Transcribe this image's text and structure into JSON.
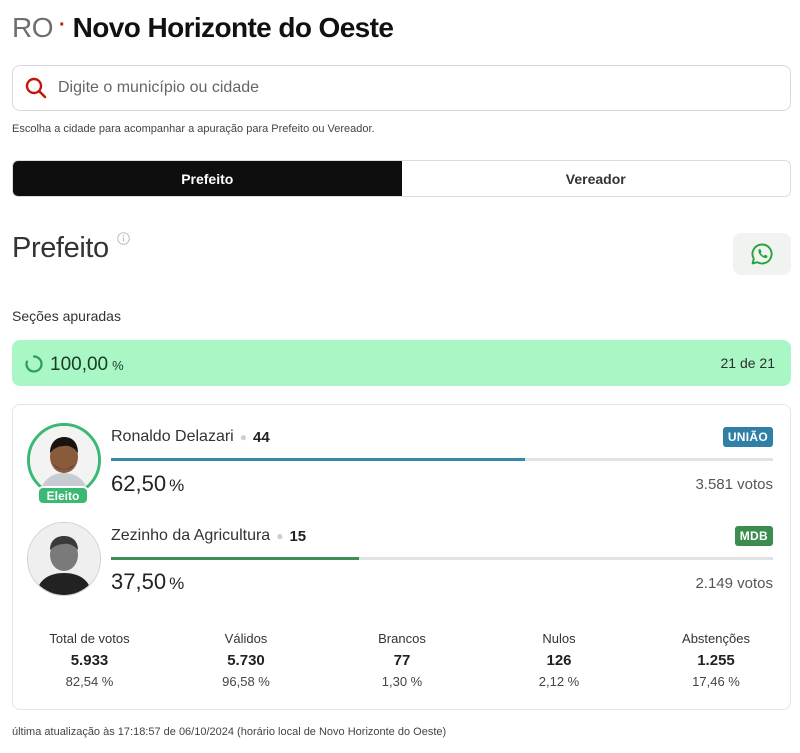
{
  "header": {
    "state": "RO",
    "separator": "·",
    "city": "Novo Horizonte do Oeste"
  },
  "search": {
    "placeholder": "Digite o município ou cidade",
    "value": ""
  },
  "hint": "Escolha a cidade para acompanhar a apuração para Prefeito ou Vereador.",
  "tabs": [
    {
      "label": "Prefeito",
      "active": true
    },
    {
      "label": "Vereador",
      "active": false
    }
  ],
  "section": {
    "title": "Prefeito"
  },
  "icons": {
    "search": "search-icon",
    "info": "info-icon",
    "share": "whatsapp-icon",
    "progress": "spinner-icon"
  },
  "progress": {
    "label": "Seções apuradas",
    "value": "100,00",
    "unit": "%",
    "count": "21 de 21",
    "fraction": 1.0,
    "color": "#a8f7c4"
  },
  "candidates": [
    {
      "name": "Ronaldo Delazari",
      "number": "44",
      "party": "UNIÃO",
      "party_color": "#2f7fa6",
      "pct": "62,50",
      "pct_unit": "%",
      "votes": "3.581 votos",
      "share": 0.625,
      "bar_color": "#3a88a8",
      "elected": true,
      "elected_label": "Eleito"
    },
    {
      "name": "Zezinho da Agricultura",
      "number": "15",
      "party": "MDB",
      "party_color": "#3a8d4f",
      "pct": "37,50",
      "pct_unit": "%",
      "votes": "2.149 votos",
      "share": 0.375,
      "bar_color": "#3d8f55",
      "elected": false
    }
  ],
  "stats": [
    {
      "label": "Total de votos",
      "value": "5.933",
      "pct": "82,54 %"
    },
    {
      "label": "Válidos",
      "value": "5.730",
      "pct": "96,58 %"
    },
    {
      "label": "Brancos",
      "value": "77",
      "pct": "1,30 %"
    },
    {
      "label": "Nulos",
      "value": "126",
      "pct": "2,12 %"
    },
    {
      "label": "Abstenções",
      "value": "1.255",
      "pct": "17,46 %"
    }
  ],
  "footer": "última atualização às 17:18:57 de 06/10/2024 (horário local de Novo Horizonte do Oeste)"
}
